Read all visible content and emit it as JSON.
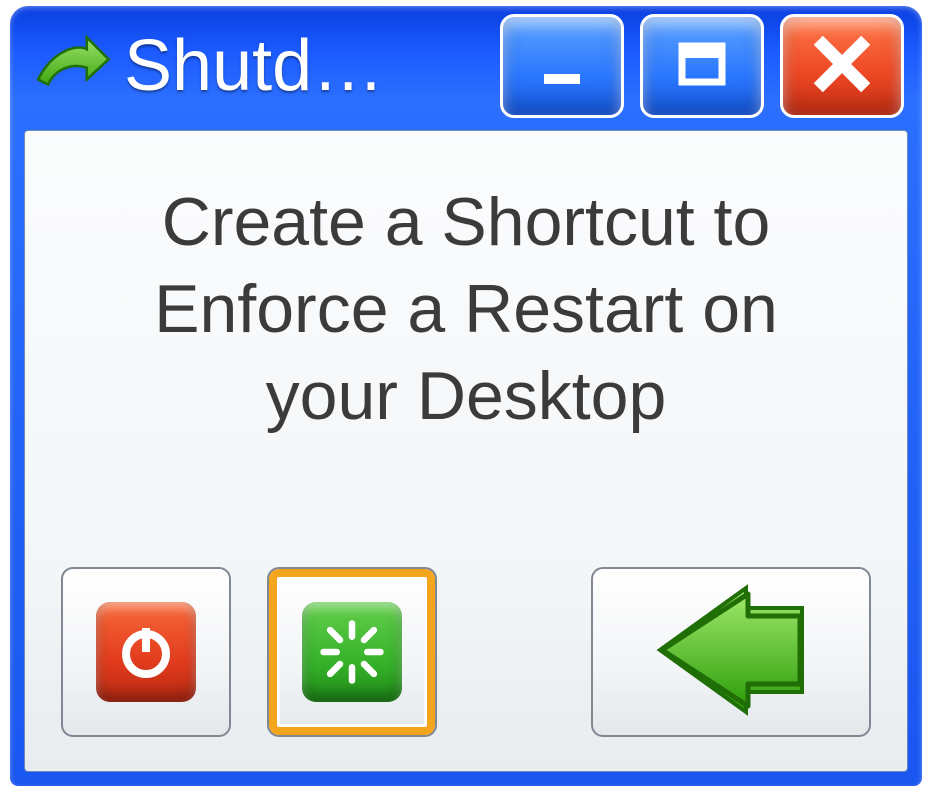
{
  "window": {
    "title": "Shutd…",
    "app_icon": "shortcut-arrow-icon"
  },
  "titlebar_buttons": {
    "minimize": "minimize-icon",
    "maximize": "maximize-icon",
    "close": "close-icon"
  },
  "body": {
    "message": "Create a Shortcut to Enforce a Restart on your Desktop"
  },
  "actions": {
    "shutdown_icon": "power-icon",
    "restart_icon": "restart-spinner-icon",
    "back_icon": "back-arrow-icon"
  },
  "colors": {
    "titlebar": "#1c5bff",
    "close_button": "#ef4a25",
    "shutdown_tile": "#e13b1d",
    "restart_tile": "#37b22a",
    "back_arrow": "#4fc31f",
    "focus_ring": "#f3a51d"
  }
}
